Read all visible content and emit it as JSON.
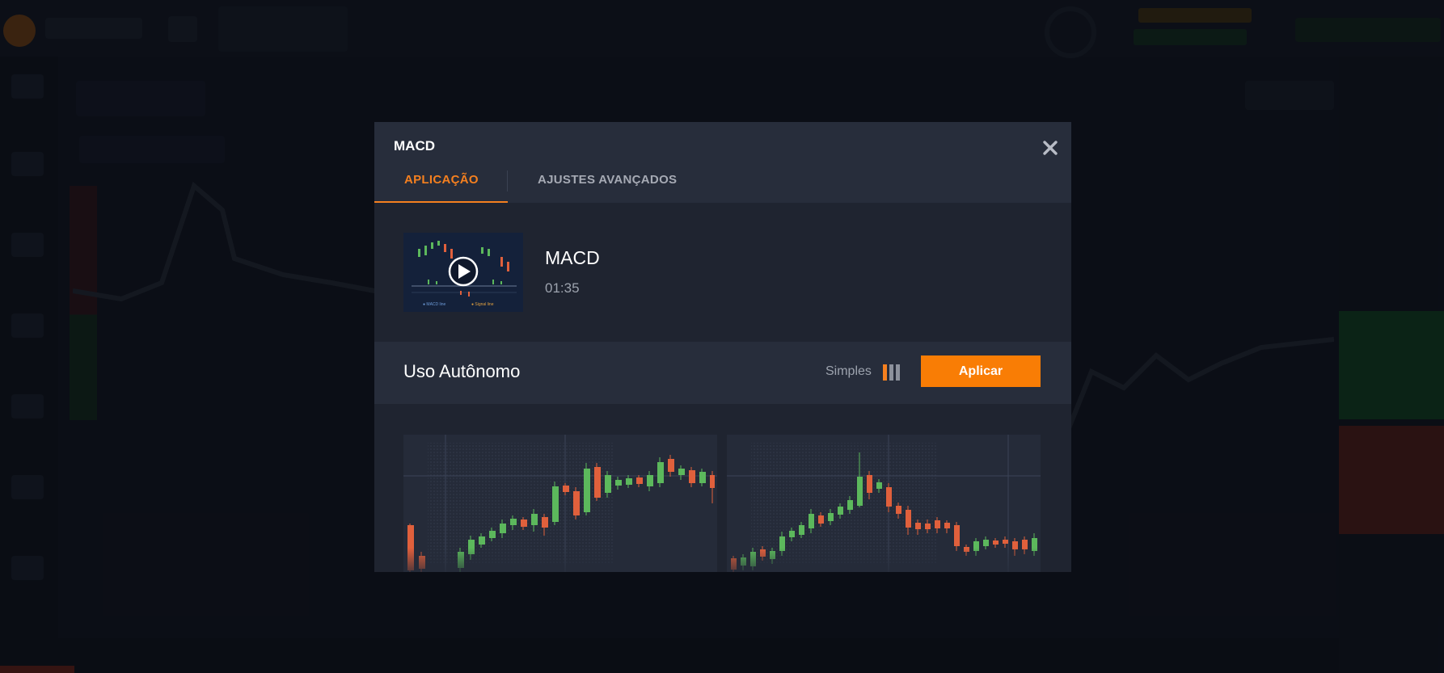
{
  "modal": {
    "title": "MACD",
    "tabs": [
      {
        "label": "APLICAÇÃO",
        "active": true
      },
      {
        "label": "AJUSTES AVANÇADOS",
        "active": false
      }
    ],
    "close_icon": "close-icon"
  },
  "video": {
    "title": "MACD",
    "duration": "01:35",
    "icon": "play-icon"
  },
  "usage": {
    "title": "Uso Autônomo",
    "mode_label": "Simples",
    "mode_icon": "layout-columns-icon",
    "apply_label": "Aplicar"
  },
  "colors": {
    "accent": "#f5801f",
    "apply_button": "#f97d05",
    "candle_up": "#5cb85c",
    "candle_down": "#e0603c",
    "modal_bg": "#1f2430",
    "header_bg": "#272d3b"
  }
}
